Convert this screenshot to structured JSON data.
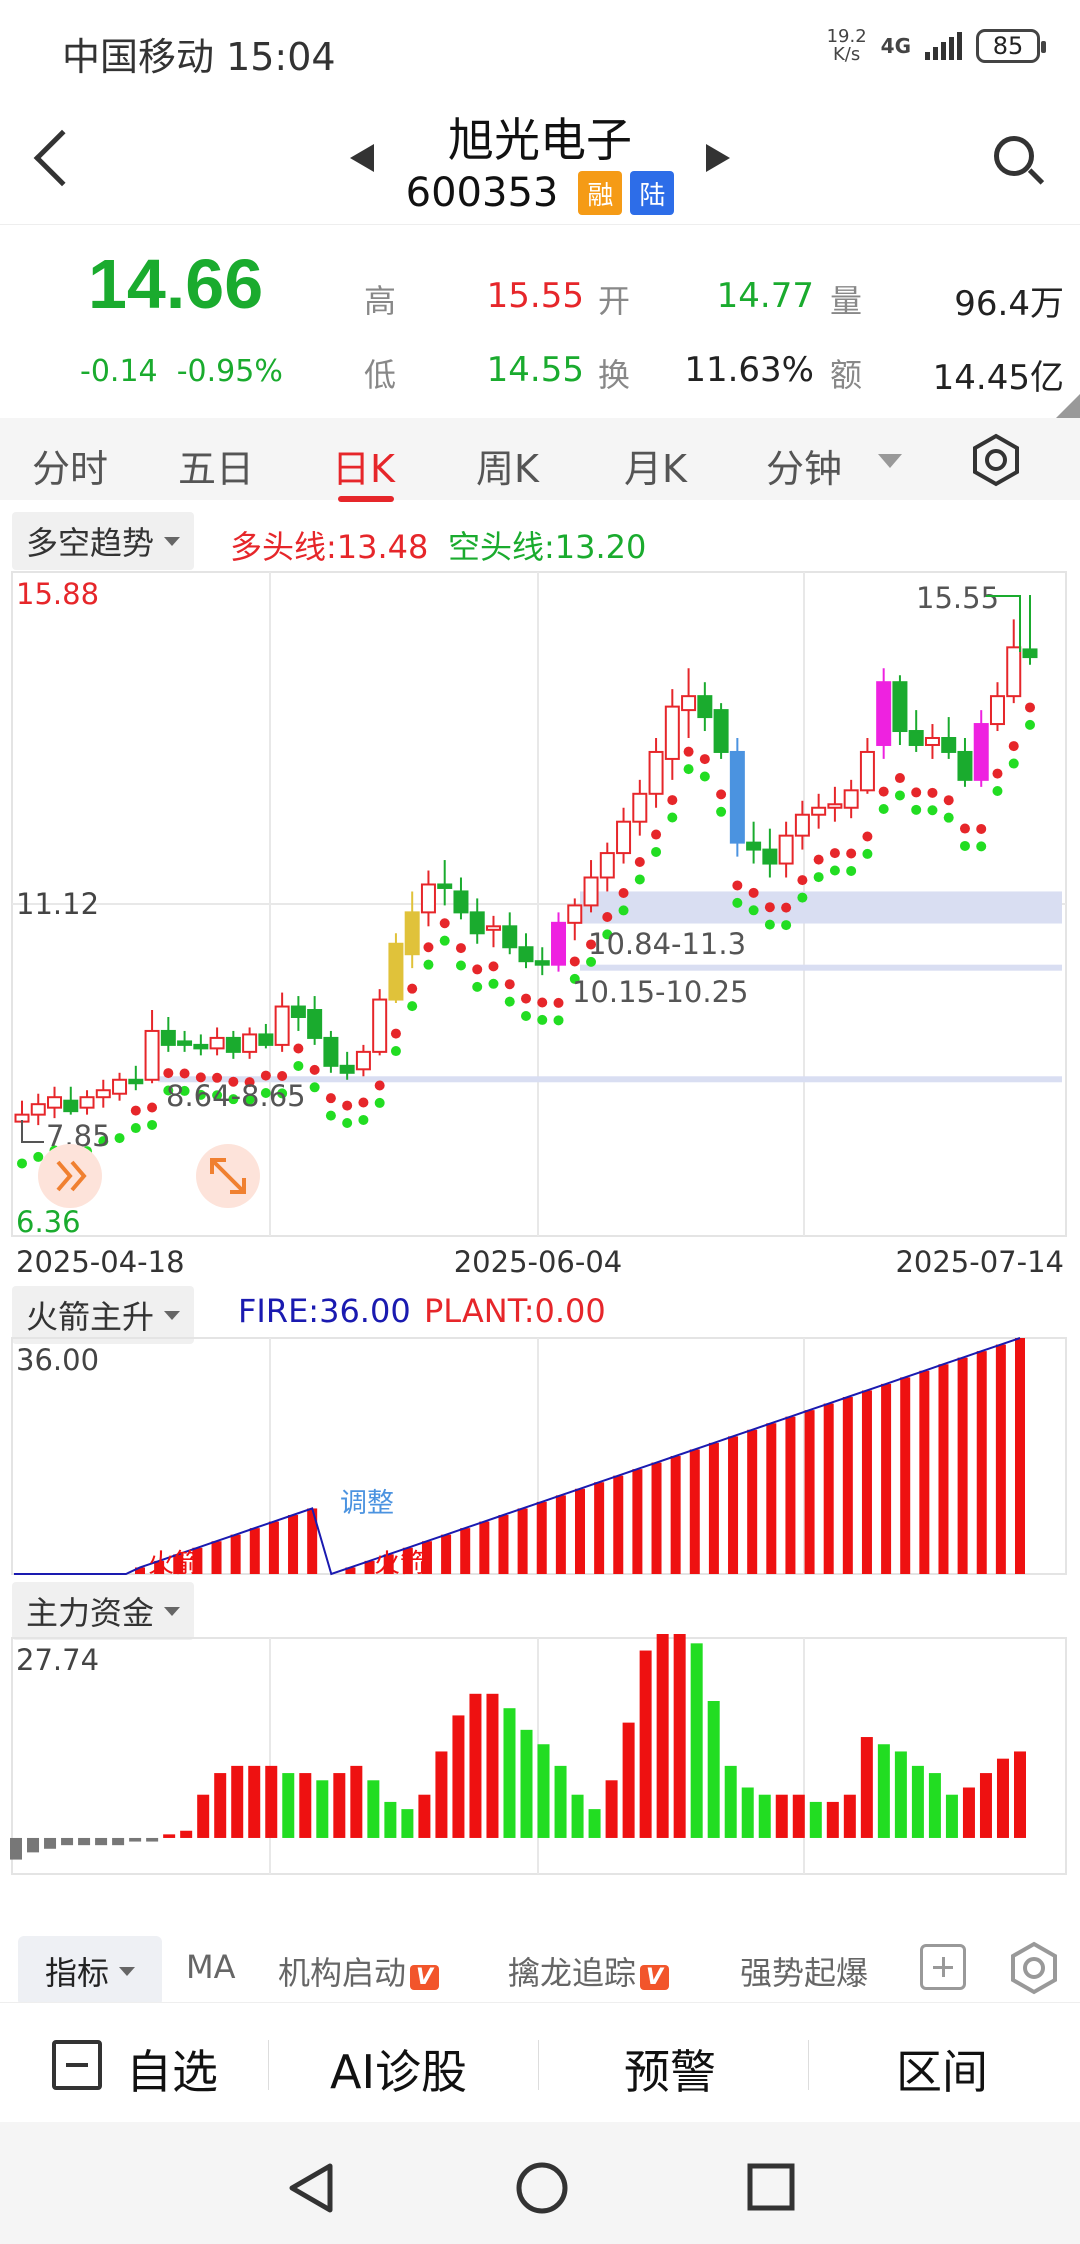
{
  "status_bar": {
    "carrier_time": "中国移动 15:04",
    "net_speed_top": "19.2",
    "net_speed_bottom": "K/s",
    "signal": "4G",
    "battery": "85"
  },
  "header": {
    "name": "旭光电子",
    "code": "600353",
    "tag_margin": "融",
    "tag_connect": "陆"
  },
  "quote": {
    "price": "14.66",
    "change": "-0.14",
    "change_pct": "-0.95%",
    "high_label": "高",
    "high": "15.55",
    "low_label": "低",
    "low": "14.55",
    "open_label": "开",
    "open": "14.77",
    "turnover_label": "换",
    "turnover": "11.63%",
    "volume_label": "量",
    "volume": "96.4万",
    "amount_label": "额",
    "amount": "14.45亿"
  },
  "tabs": [
    "分时",
    "五日",
    "日K",
    "周K",
    "月K",
    "分钟"
  ],
  "active_tab": "日K",
  "main_indicator": {
    "name": "多空趋势",
    "bull_label": "多头线:13.48",
    "bear_label": "空头线:13.20"
  },
  "main_chart": {
    "y_max": "15.88",
    "y_mid": "11.12",
    "y_min": "6.36",
    "x_labels": [
      "2025-04-18",
      "2025-06-04",
      "2025-07-14"
    ],
    "high_mark": "15.55",
    "low_mark": "7.85",
    "zone1": "10.84-11.3",
    "zone2": "10.15-10.25",
    "zone3": "8.64-8.65"
  },
  "sub1": {
    "name": "火箭主升",
    "fire_label": "FIRE:36.00",
    "plant_label": "PLANT:0.00",
    "y_max": "36.00",
    "tag_rocket1": "火箭",
    "tag_adjust": "调整",
    "tag_rocket2": "火箭"
  },
  "sub2": {
    "name": "主力资金",
    "y_max": "27.74"
  },
  "toolbar": {
    "indicator": "指标",
    "ma": "MA",
    "inst": "机构启动",
    "dragon": "擒龙追踪",
    "strong": "强势起爆",
    "v_badge": "V"
  },
  "actions": {
    "watchlist": "自选",
    "ai": "AI诊股",
    "alert": "预警",
    "range": "区间"
  },
  "colors": {
    "up": "#e6262a",
    "down": "#1aab2e",
    "accent": "#e6262a"
  },
  "chart_data": [
    {
      "type": "candlestick",
      "x": [
        "2025-04-18",
        "2025-06-04",
        "2025-07-14"
      ],
      "ylim": [
        6.36,
        15.88
      ],
      "candles": [
        {
          "o": 8.0,
          "h": 8.3,
          "l": 7.85,
          "c": 8.1
        },
        {
          "o": 8.1,
          "h": 8.4,
          "l": 7.95,
          "c": 8.25
        },
        {
          "o": 8.2,
          "h": 8.5,
          "l": 8.05,
          "c": 8.35
        },
        {
          "o": 8.3,
          "h": 8.5,
          "l": 8.1,
          "c": 8.15
        },
        {
          "o": 8.2,
          "h": 8.45,
          "l": 8.1,
          "c": 8.35
        },
        {
          "o": 8.35,
          "h": 8.6,
          "l": 8.2,
          "c": 8.45
        },
        {
          "o": 8.4,
          "h": 8.7,
          "l": 8.3,
          "c": 8.6
        },
        {
          "o": 8.6,
          "h": 8.8,
          "l": 8.45,
          "c": 8.55
        },
        {
          "o": 8.6,
          "h": 9.6,
          "l": 8.55,
          "c": 9.3
        },
        {
          "o": 9.3,
          "h": 9.5,
          "l": 9.0,
          "c": 9.1
        },
        {
          "o": 9.15,
          "h": 9.3,
          "l": 9.0,
          "c": 9.1
        },
        {
          "o": 9.1,
          "h": 9.25,
          "l": 8.95,
          "c": 9.05
        },
        {
          "o": 9.05,
          "h": 9.35,
          "l": 8.95,
          "c": 9.2
        },
        {
          "o": 9.2,
          "h": 9.3,
          "l": 8.9,
          "c": 9.0
        },
        {
          "o": 9.0,
          "h": 9.35,
          "l": 8.9,
          "c": 9.25
        },
        {
          "o": 9.25,
          "h": 9.4,
          "l": 9.05,
          "c": 9.1
        },
        {
          "o": 9.1,
          "h": 9.85,
          "l": 9.0,
          "c": 9.65
        },
        {
          "o": 9.65,
          "h": 9.8,
          "l": 9.3,
          "c": 9.5
        },
        {
          "o": 9.6,
          "h": 9.8,
          "l": 9.1,
          "c": 9.2
        },
        {
          "o": 9.2,
          "h": 9.3,
          "l": 8.7,
          "c": 8.8
        },
        {
          "o": 8.8,
          "h": 9.0,
          "l": 8.6,
          "c": 8.7
        },
        {
          "o": 8.75,
          "h": 9.1,
          "l": 8.65,
          "c": 9.0
        },
        {
          "o": 9.0,
          "h": 9.9,
          "l": 8.95,
          "c": 9.75
        },
        {
          "o": 9.75,
          "h": 10.7,
          "l": 9.7,
          "c": 10.55
        },
        {
          "o": 10.4,
          "h": 11.3,
          "l": 10.2,
          "c": 11.0
        },
        {
          "o": 11.0,
          "h": 11.6,
          "l": 10.8,
          "c": 11.4
        },
        {
          "o": 11.4,
          "h": 11.75,
          "l": 11.1,
          "c": 11.35
        },
        {
          "o": 11.3,
          "h": 11.5,
          "l": 10.9,
          "c": 11.0
        },
        {
          "o": 11.0,
          "h": 11.2,
          "l": 10.55,
          "c": 10.7
        },
        {
          "o": 10.75,
          "h": 10.95,
          "l": 10.5,
          "c": 10.8
        },
        {
          "o": 10.8,
          "h": 11.0,
          "l": 10.4,
          "c": 10.5
        },
        {
          "o": 10.5,
          "h": 10.7,
          "l": 10.2,
          "c": 10.3
        },
        {
          "o": 10.3,
          "h": 10.5,
          "l": 10.1,
          "c": 10.25
        },
        {
          "o": 10.25,
          "h": 11.0,
          "l": 10.15,
          "c": 10.85
        },
        {
          "o": 10.85,
          "h": 11.2,
          "l": 10.6,
          "c": 11.1
        },
        {
          "o": 11.1,
          "h": 11.75,
          "l": 11.0,
          "c": 11.5
        },
        {
          "o": 11.5,
          "h": 12.0,
          "l": 11.3,
          "c": 11.85
        },
        {
          "o": 11.85,
          "h": 12.5,
          "l": 11.7,
          "c": 12.3
        },
        {
          "o": 12.3,
          "h": 12.9,
          "l": 12.1,
          "c": 12.7
        },
        {
          "o": 12.7,
          "h": 13.5,
          "l": 12.5,
          "c": 13.3
        },
        {
          "o": 13.2,
          "h": 14.2,
          "l": 12.9,
          "c": 13.95
        },
        {
          "o": 13.9,
          "h": 14.5,
          "l": 13.5,
          "c": 14.1
        },
        {
          "o": 14.1,
          "h": 14.3,
          "l": 13.6,
          "c": 13.8
        },
        {
          "o": 13.9,
          "h": 14.0,
          "l": 13.2,
          "c": 13.3
        },
        {
          "o": 13.3,
          "h": 13.5,
          "l": 11.8,
          "c": 12.0
        },
        {
          "o": 12.0,
          "h": 12.3,
          "l": 11.7,
          "c": 11.9
        },
        {
          "o": 11.9,
          "h": 12.2,
          "l": 11.5,
          "c": 11.7
        },
        {
          "o": 11.7,
          "h": 12.3,
          "l": 11.5,
          "c": 12.1
        },
        {
          "o": 12.1,
          "h": 12.6,
          "l": 11.9,
          "c": 12.4
        },
        {
          "o": 12.4,
          "h": 12.7,
          "l": 12.2,
          "c": 12.5
        },
        {
          "o": 12.5,
          "h": 12.8,
          "l": 12.3,
          "c": 12.55
        },
        {
          "o": 12.5,
          "h": 12.9,
          "l": 12.35,
          "c": 12.75
        },
        {
          "o": 12.75,
          "h": 13.5,
          "l": 12.7,
          "c": 13.3
        },
        {
          "o": 13.4,
          "h": 14.5,
          "l": 13.2,
          "c": 14.3
        },
        {
          "o": 14.3,
          "h": 14.4,
          "l": 13.4,
          "c": 13.6
        },
        {
          "o": 13.6,
          "h": 13.9,
          "l": 13.3,
          "c": 13.4
        },
        {
          "o": 13.4,
          "h": 13.7,
          "l": 13.2,
          "c": 13.5
        },
        {
          "o": 13.5,
          "h": 13.8,
          "l": 13.2,
          "c": 13.3
        },
        {
          "o": 13.3,
          "h": 13.5,
          "l": 12.8,
          "c": 12.9
        },
        {
          "o": 12.9,
          "h": 13.9,
          "l": 12.8,
          "c": 13.7
        },
        {
          "o": 13.7,
          "h": 14.3,
          "l": 13.6,
          "c": 14.1
        },
        {
          "o": 14.1,
          "h": 15.2,
          "l": 14.0,
          "c": 14.8
        },
        {
          "o": 14.77,
          "h": 15.55,
          "l": 14.55,
          "c": 14.66
        }
      ]
    },
    {
      "type": "bar",
      "name": "FIRE",
      "values": [
        0,
        0,
        0,
        0,
        0,
        0,
        0,
        0,
        1,
        2,
        3,
        4,
        5,
        6,
        7,
        8,
        9,
        10,
        0,
        1,
        2,
        3,
        4,
        5,
        6,
        7,
        8,
        9,
        10,
        11,
        12,
        13,
        14,
        15,
        16,
        17,
        18,
        19,
        20,
        21,
        22,
        23,
        24,
        25,
        26,
        27,
        28,
        29,
        30,
        31,
        32,
        33,
        34,
        35,
        36
      ],
      "ylim": [
        0,
        36
      ]
    },
    {
      "type": "bar",
      "name": "主力资金",
      "values": [
        -3,
        -2,
        -1.5,
        -1,
        -1,
        -1,
        -1,
        -0.5,
        -0.5,
        0.5,
        1,
        6,
        9,
        10,
        10,
        10,
        9,
        9,
        8,
        9,
        10,
        8,
        5,
        4,
        6,
        12,
        17,
        20,
        20,
        18,
        15,
        13,
        10,
        6,
        4,
        8,
        16,
        26,
        29,
        30,
        27,
        19,
        10,
        7,
        6,
        6,
        6,
        5,
        5,
        6,
        14,
        13,
        12,
        10,
        9,
        6,
        7,
        9,
        11,
        12
      ],
      "ylim": [
        -5,
        27.74
      ]
    }
  ]
}
